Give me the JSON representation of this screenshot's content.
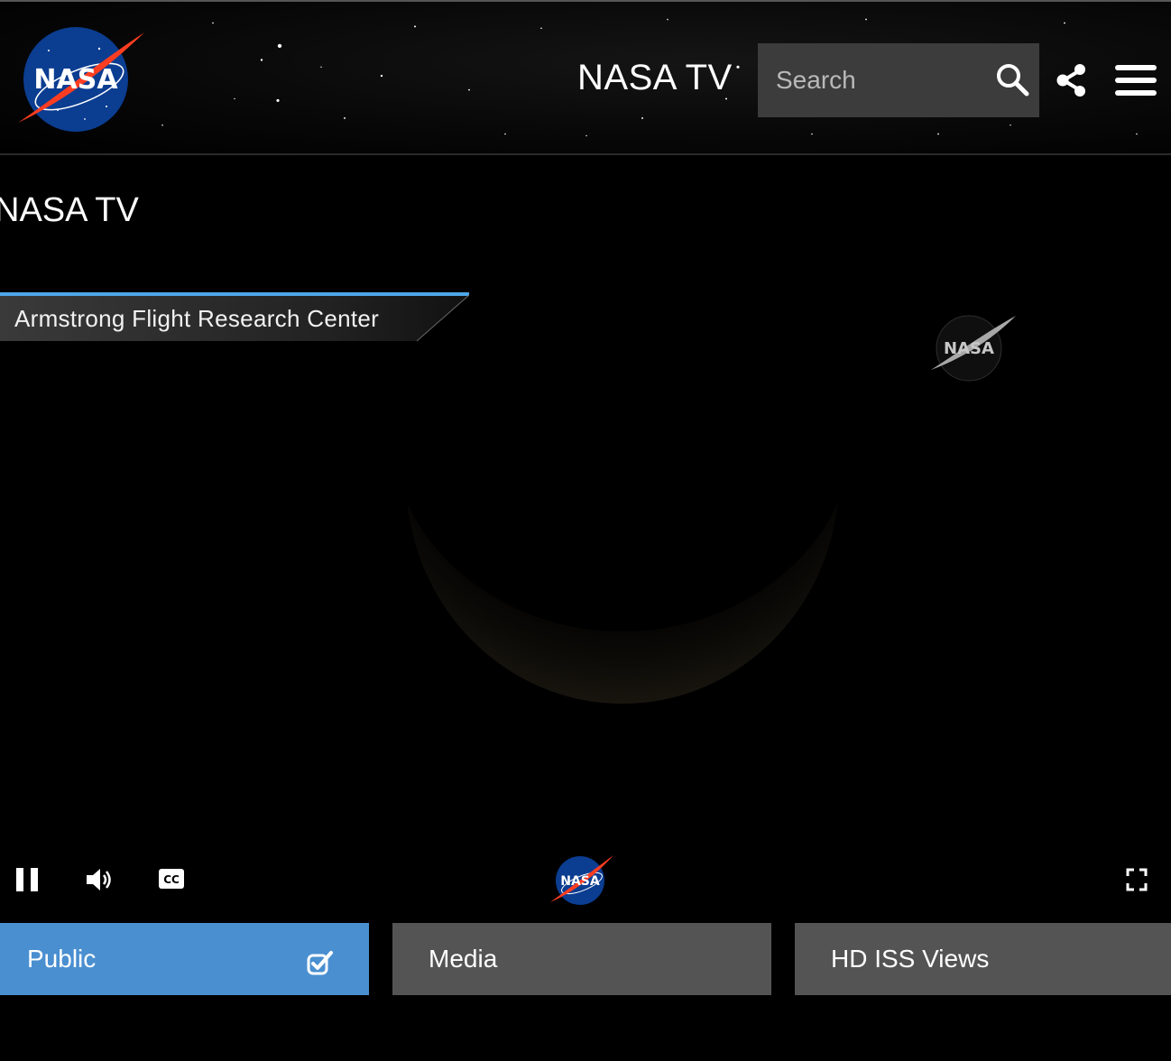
{
  "header": {
    "logo_text": "NASA",
    "site_title": "NASA TV",
    "search": {
      "placeholder": "Search",
      "value": ""
    },
    "icons": {
      "search": "search-icon",
      "share": "share-icon",
      "menu": "hamburger-menu-icon"
    }
  },
  "page": {
    "heading": "NASA TV"
  },
  "video": {
    "lower_third": "Armstrong Flight Research Center",
    "bug_text": "NASA",
    "controls": {
      "pause": "pause-icon",
      "volume": "volume-icon",
      "captions": "CC",
      "player_logo_text": "NASA",
      "fullscreen": "fullscreen-icon"
    }
  },
  "channels": {
    "tabs": [
      {
        "label": "Public",
        "selected": true
      },
      {
        "label": "Media",
        "selected": false
      },
      {
        "label": "HD ISS Views",
        "selected": false
      }
    ]
  },
  "colors": {
    "selected_tab": "#4a8fd0",
    "tab": "#545454",
    "search_bg": "#3c3c3c",
    "lower_third_accent": "#4fa6e8"
  }
}
